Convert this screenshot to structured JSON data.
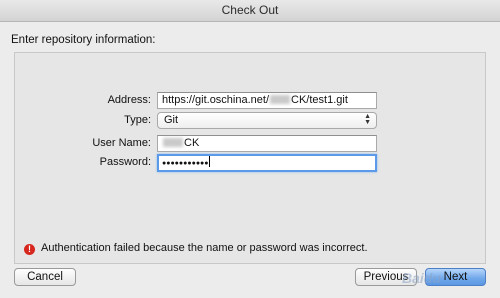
{
  "window": {
    "title": "Check Out"
  },
  "heading": "Enter repository information:",
  "form": {
    "address_label": "Address:",
    "address_prefix": "https://git.oschina.net/",
    "address_suffix": "CK/test1.git",
    "type_label": "Type:",
    "type_value": "Git",
    "username_label": "User Name:",
    "username_suffix": "CK",
    "password_label": "Password:",
    "password_mask": "●●●●●●●●●●●"
  },
  "error": {
    "message": "Authentication failed because the name or password was incorrect."
  },
  "buttons": {
    "cancel": "Cancel",
    "previous": "Previous",
    "next": "Next"
  },
  "watermark": "Baidu"
}
